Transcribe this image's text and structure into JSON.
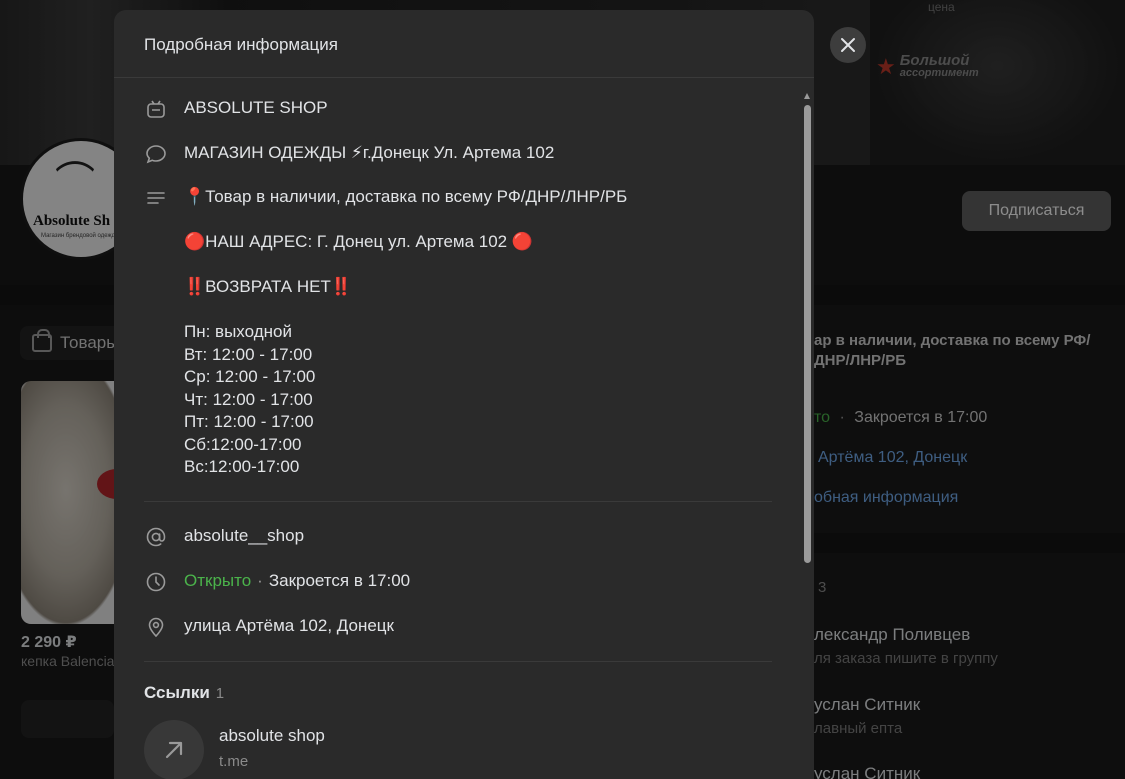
{
  "background": {
    "promo": {
      "top_text": "цена",
      "title": "Большой",
      "subtitle": "ассортимент"
    },
    "avatar": {
      "text": "Absolute Sh",
      "subtext": "Магазин брендовой одежды"
    },
    "subscribe_label": "Подписаться",
    "goods_tab_label": "Товары",
    "product": {
      "price": "2 290 ₽",
      "name": "кепка Balenciaga"
    },
    "right_panel": {
      "description": "ар в наличии, доставка по всему РФ/ДНР/ЛНР/РБ",
      "status_open": "то",
      "status_close": "Закроется в 17:00",
      "address": "Артёма 102, Донецк",
      "more_info": "обная информация",
      "members_count": "3",
      "people": [
        {
          "name": "лександр Поливцев",
          "sub": "ля заказа пишите в группу"
        },
        {
          "name": "услан Ситник",
          "sub": "лавный епта"
        },
        {
          "name": "услан Ситник",
          "sub": ""
        }
      ]
    }
  },
  "modal": {
    "title": "Подробная информация",
    "name": "ABSOLUTE SHOP",
    "status_line": "МАГАЗИН ОДЕЖДЫ ⚡г.Донецк Ул. Артема 102",
    "description_lines": [
      "📍Товар в наличии, доставка по всему РФ/ДНР/ЛНР/РБ",
      "🔴НАШ АДРЕС: Г. Донец ул. Артема 102 🔴",
      "‼️ВОЗВРАТА НЕТ‼️",
      "Пн: выходной\nВт: 12:00 - 17:00\nСр: 12:00 - 17:00\nЧт: 12:00 - 17:00\nПт: 12:00 - 17:00\nСб:12:00-17:00\nВс:12:00-17:00"
    ],
    "username": "absolute__shop",
    "hours": {
      "open": "Открыто",
      "separator": "·",
      "closes": "Закроется в 17:00"
    },
    "address": "улица Артёма 102, Донецк",
    "links": {
      "title": "Ссылки",
      "count": "1",
      "items": [
        {
          "name": "absolute shop",
          "domain": "t.me"
        }
      ]
    }
  },
  "icons": {
    "name": "bot-icon",
    "status": "chat-bubble-icon",
    "description": "text-lines-icon",
    "username": "at-icon",
    "hours": "clock-icon",
    "address": "location-pin-icon",
    "link": "arrow-up-right-icon",
    "close": "close-icon"
  },
  "colors": {
    "accent_link": "#71aaeb",
    "open_green": "#4bb34b",
    "modal_bg": "#2a2a2a"
  }
}
